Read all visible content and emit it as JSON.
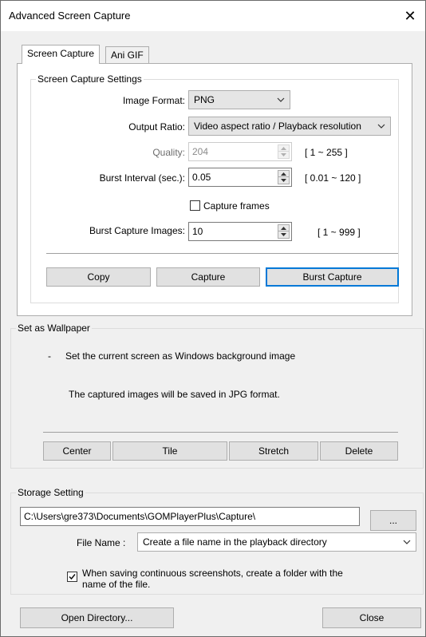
{
  "window": {
    "title": "Advanced Screen Capture",
    "close_glyph": "✕"
  },
  "tabs": [
    {
      "label": "Screen Capture",
      "active": true
    },
    {
      "label": "Ani GIF",
      "active": false
    }
  ],
  "screen_capture": {
    "group_label": "Screen Capture Settings",
    "image_format": {
      "label": "Image Format:",
      "value": "PNG"
    },
    "output_ratio": {
      "label": "Output Ratio:",
      "value": "Video aspect ratio / Playback resolution"
    },
    "quality": {
      "label": "Quality:",
      "value": "204",
      "range": "[ 1 ~ 255 ]",
      "enabled": false
    },
    "burst_interval": {
      "label": "Burst Interval (sec.):",
      "value": "0.05",
      "range": "[ 0.01 ~ 120 ]"
    },
    "capture_frames": {
      "label": "Capture frames",
      "checked": false
    },
    "burst_images": {
      "label": "Burst Capture Images:",
      "value": "10",
      "range": "[ 1 ~ 999 ]"
    },
    "buttons": {
      "copy": "Copy",
      "capture": "Capture",
      "burst_capture": "Burst Capture"
    }
  },
  "wallpaper": {
    "group_label": "Set as Wallpaper",
    "bullet": "-",
    "description": "Set the current screen as Windows background image",
    "note": "The captured images will be saved in JPG format.",
    "buttons": {
      "center": "Center",
      "tile": "Tile",
      "stretch": "Stretch",
      "delete": "Delete"
    }
  },
  "storage": {
    "group_label": "Storage Setting",
    "path": "C:\\Users\\gre373\\Documents\\GOMPlayerPlus\\Capture\\",
    "browse_label": "...",
    "file_name_label": "File Name :",
    "file_name_value": "Create a file name in the playback directory",
    "folder_option": {
      "label_line1": "When saving continuous screenshots, create a folder with the",
      "label_line2": "name of the file.",
      "checked": true
    }
  },
  "footer": {
    "open_directory": "Open Directory...",
    "close": "Close"
  },
  "colors": {
    "accent": "#0078d7",
    "window_bg": "#f0f0f0",
    "button_bg": "#e1e1e1"
  }
}
